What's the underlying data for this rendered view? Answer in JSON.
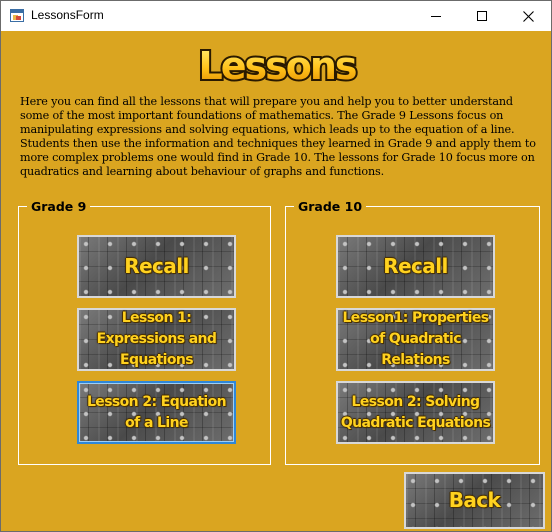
{
  "window": {
    "title": "LessonsForm"
  },
  "controls": {
    "minimize": "minimize",
    "maximize": "maximize",
    "close": "close"
  },
  "header": {
    "logo_text": "Lessons"
  },
  "intro": "Here you can find all the lessons that will prepare you and help you to better understand some of the most important foundations of mathematics. The Grade 9 Lessons focus on manipulating expressions and solving equations, which leads up to the equation of a line. Students then use the information and techniques they learned in Grade 9 and apply them to more complex problems one would find in Grade 10. The lessons for Grade 10 focus more on quadratics and learning about behaviour of graphs and functions.",
  "grade9": {
    "title": "Grade 9",
    "recall": "Recall",
    "lesson1": "Lesson 1: Expressions and Equations",
    "lesson2": "Lesson 2: Equation of a Line"
  },
  "grade10": {
    "title": "Grade 10",
    "recall": "Recall",
    "lesson1": "Lesson1: Properties of Quadratic Relations",
    "lesson2": "Lesson 2: Solving Quadratic Equations"
  },
  "back_label": "Back",
  "colors": {
    "background": "#daa520",
    "button_text": "#ffd21f",
    "focus_border": "#2e87d8"
  }
}
